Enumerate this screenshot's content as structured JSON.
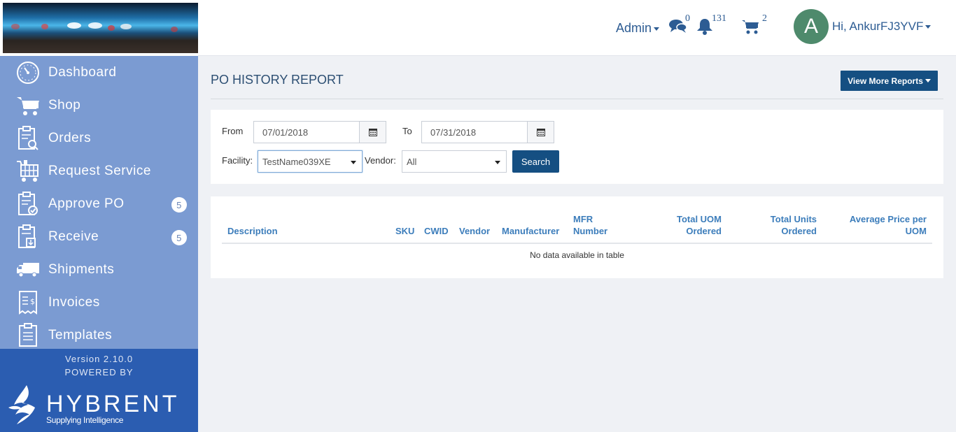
{
  "header": {
    "admin_label": "Admin",
    "messages_count": "0",
    "notifications_count": "131",
    "cart_count": "2",
    "avatar_initial": "A",
    "greeting": "Hi, AnkurFJ3YVF"
  },
  "sidebar": {
    "items": [
      {
        "label": "Dashboard",
        "icon": "dashboard-gauge-icon"
      },
      {
        "label": "Shop",
        "icon": "shopping-cart-icon"
      },
      {
        "label": "Orders",
        "icon": "clipboard-search-icon"
      },
      {
        "label": "Request Service",
        "icon": "service-cart-icon"
      },
      {
        "label": "Approve PO",
        "icon": "clipboard-check-icon",
        "badge": "5"
      },
      {
        "label": "Receive",
        "icon": "clipboard-download-icon",
        "badge": "5"
      },
      {
        "label": "Shipments",
        "icon": "truck-icon"
      },
      {
        "label": "Invoices",
        "icon": "invoice-icon"
      },
      {
        "label": "Templates",
        "icon": "clipboard-list-icon"
      }
    ],
    "version": "Version 2.10.0",
    "powered_by": "POWERED BY",
    "brand_name": "HYBRENT",
    "brand_tagline": "Supplying Intelligence"
  },
  "page": {
    "title": "PO HISTORY REPORT",
    "more_reports_label": "View More Reports"
  },
  "filters": {
    "from_label": "From",
    "from_value": "07/01/2018",
    "to_label": "To",
    "to_value": "07/31/2018",
    "facility_label": "Facility:",
    "facility_value": "TestName039XE",
    "vendor_label": "Vendor:",
    "vendor_value": "All",
    "search_label": "Search"
  },
  "table": {
    "columns": [
      "Description",
      "SKU",
      "CWID",
      "Vendor",
      "Manufacturer",
      "MFR Number",
      "Total UOM Ordered",
      "Total Units Ordered",
      "Average Price per UOM"
    ],
    "empty_message": "No data available in table"
  },
  "colors": {
    "sidebar": "#7b9bd2",
    "sidebar_footer": "#2b5db1",
    "primary_button": "#154f82",
    "header_text": "#2d5c93",
    "table_header_text": "#3c7dbb"
  }
}
